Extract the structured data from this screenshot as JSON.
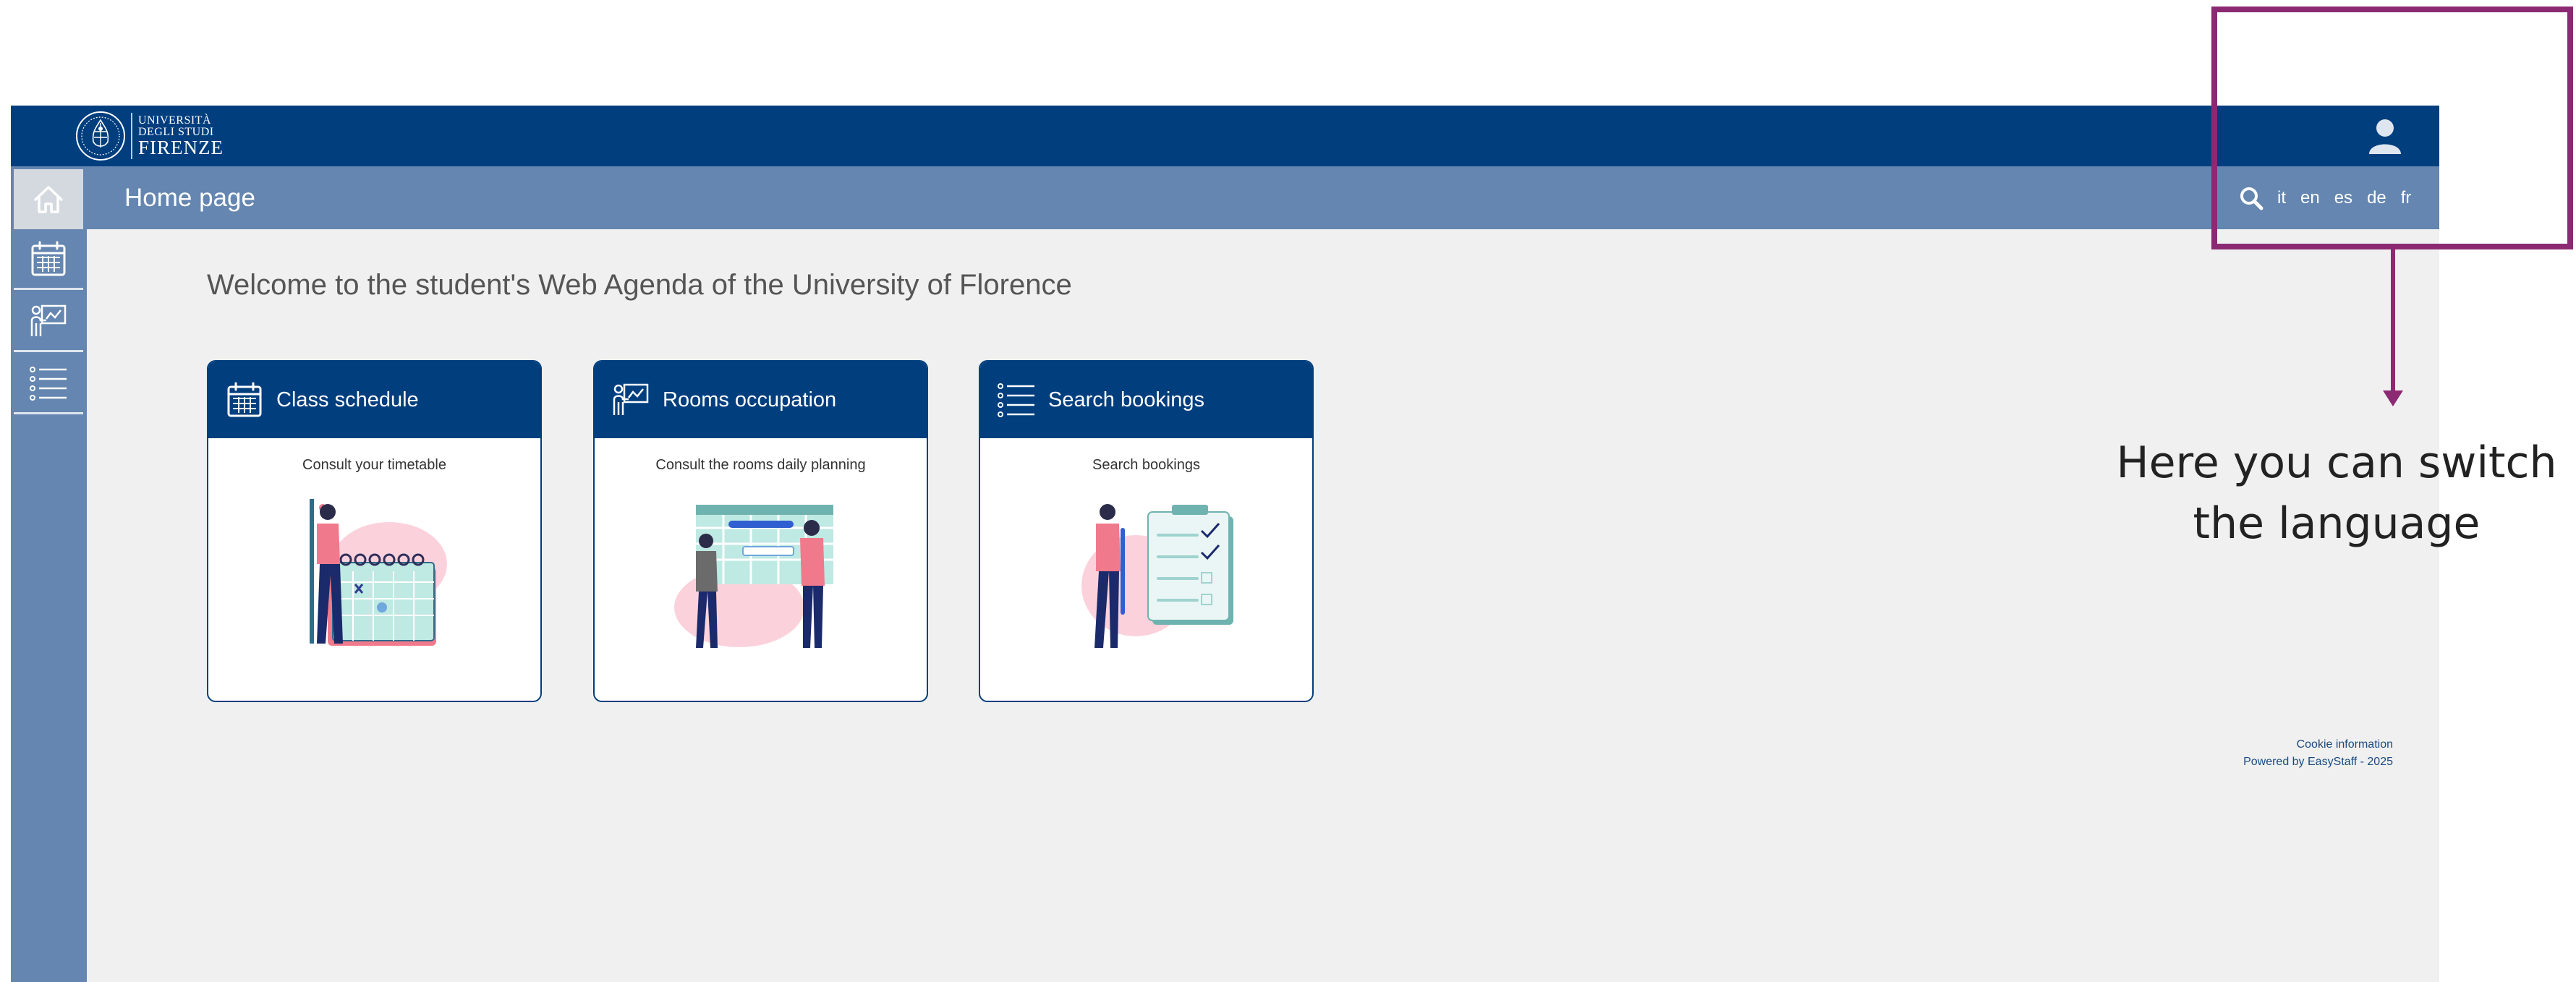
{
  "header": {
    "logo": {
      "line1": "UNIVERSITÀ",
      "line2": "DEGLI STUDI",
      "line3": "FIRENZE"
    },
    "user_icon": "user-icon"
  },
  "subbar": {
    "page_title": "Home page",
    "search_icon": "search-icon",
    "languages": [
      "it",
      "en",
      "es",
      "de",
      "fr"
    ]
  },
  "sidebar": {
    "items": [
      {
        "name": "home",
        "icon": "home-icon"
      },
      {
        "name": "class-schedule",
        "icon": "calendar-icon"
      },
      {
        "name": "rooms-occupation",
        "icon": "presentation-icon"
      },
      {
        "name": "search-bookings",
        "icon": "list-icon"
      }
    ]
  },
  "main": {
    "welcome": "Welcome to the student's Web Agenda of the University of Florence",
    "cards": [
      {
        "title": "Class schedule",
        "description": "Consult your timetable",
        "icon": "calendar-icon"
      },
      {
        "title": "Rooms occupation",
        "description": "Consult the rooms daily planning",
        "icon": "presentation-icon"
      },
      {
        "title": "Search bookings",
        "description": "Search bookings",
        "icon": "list-icon"
      }
    ]
  },
  "footer": {
    "cookie": "Cookie information",
    "powered": "Powered by EasyStaff - 2025"
  },
  "annotation": {
    "callout_line1": "Here you can switch",
    "callout_line2": "the language",
    "color": "#8b2a73"
  },
  "colors": {
    "primary": "#003e7e",
    "secondary": "#6486b0",
    "background": "#f0f0f0",
    "accent_pink": "#f07a8c"
  }
}
